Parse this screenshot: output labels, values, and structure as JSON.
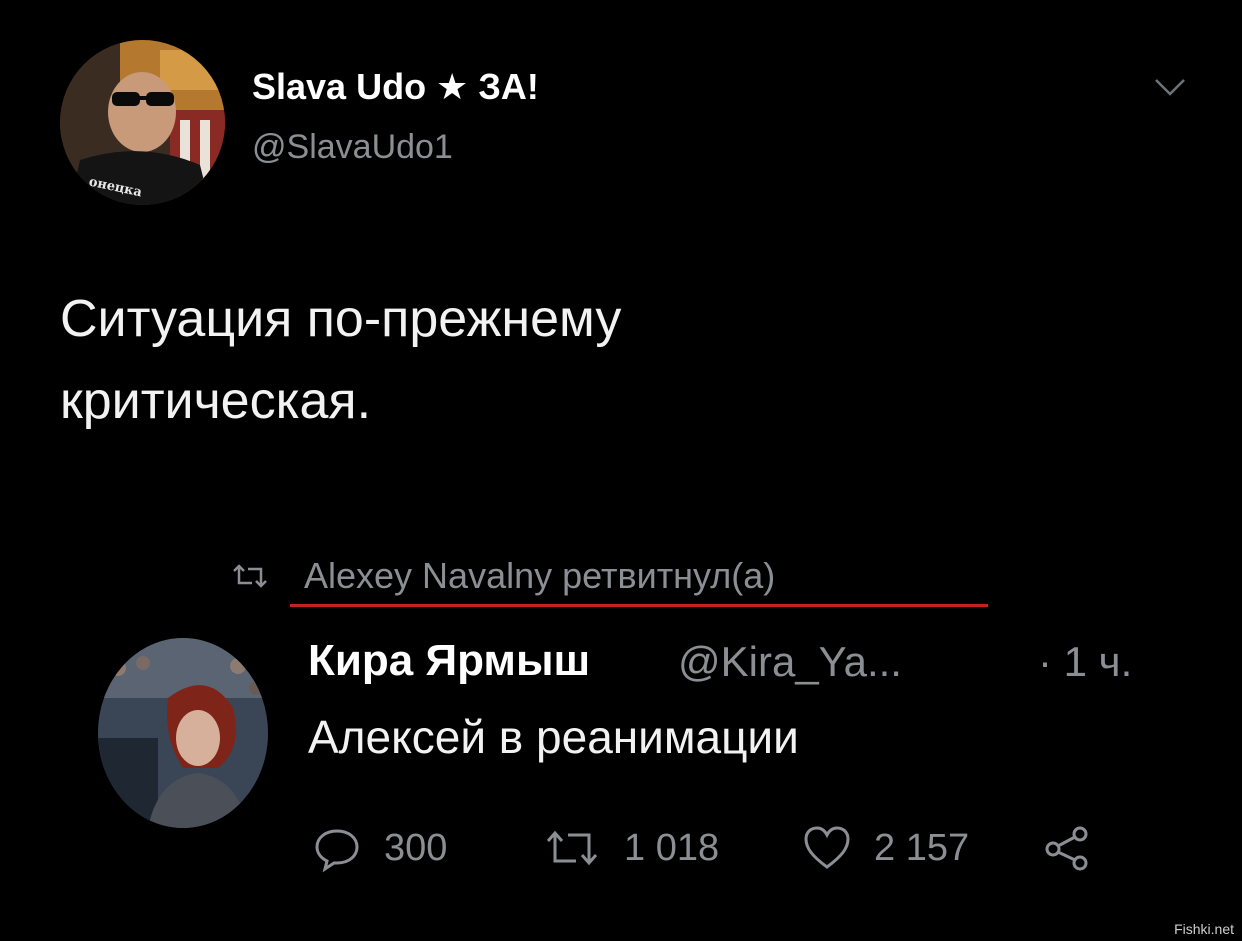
{
  "tweet": {
    "author": {
      "name": "Slava Udo ★ ЗА!",
      "handle": "@SlavaUdo1",
      "shirt_text": "онецка"
    },
    "text_lines": [
      "Ситуация по-прежнему",
      "критическая."
    ]
  },
  "retweet": {
    "label": "Alexey Navalny ретвитнул(а)"
  },
  "quoted": {
    "name": "Кира Ярмыш",
    "handle": "@Kira_Ya...",
    "time": "· 1 ч.",
    "text": "Алексей в реанимации",
    "stats": {
      "replies": "300",
      "retweets": "1 018",
      "likes": "2 157"
    }
  },
  "watermark": "Fishki.net",
  "colors": {
    "background": "#000000",
    "text": "#f2f2f2",
    "muted": "#8b8f94",
    "underline": "#c8201e"
  },
  "icons": {
    "menu": "chevron-down-icon",
    "retweet": "retweet-icon",
    "reply": "reply-icon",
    "like": "heart-icon",
    "share": "share-icon"
  }
}
